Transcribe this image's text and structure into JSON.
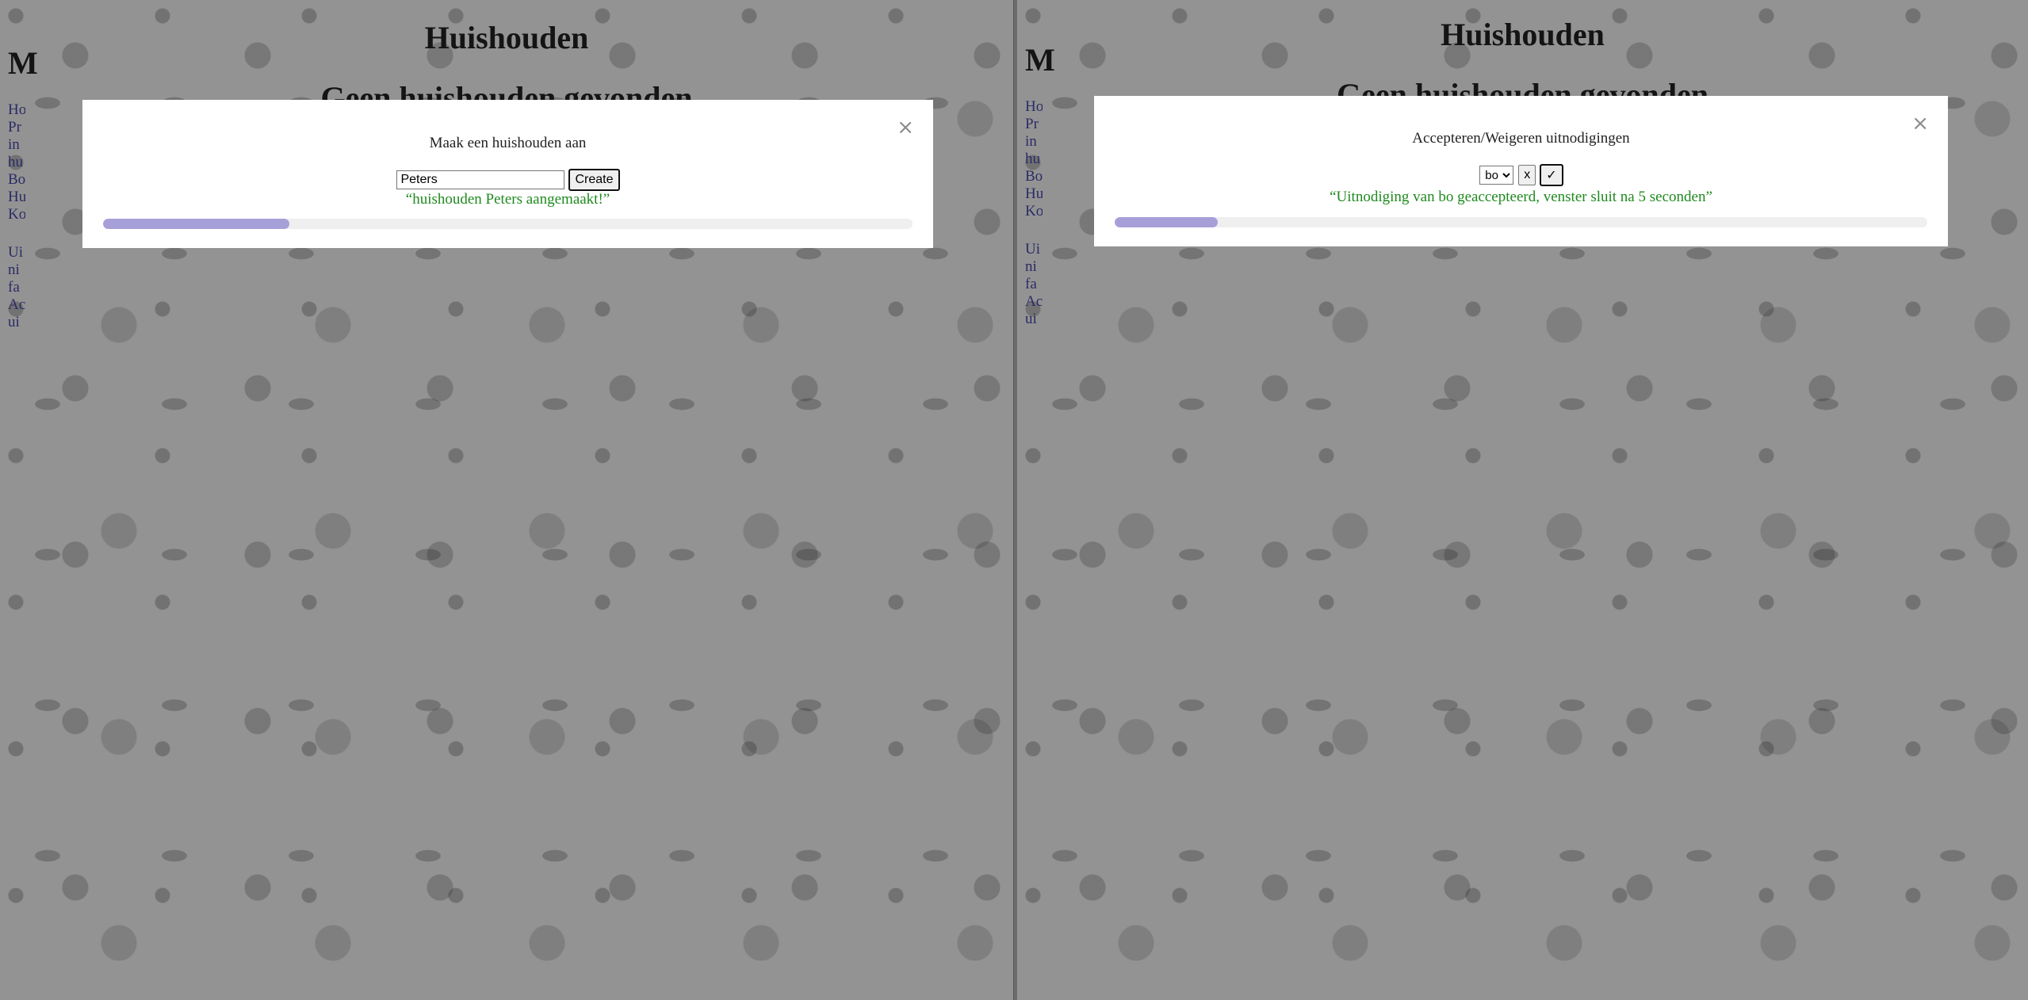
{
  "left": {
    "page_title": "Huishouden",
    "page_subtitle": "Geen huishouden gevonden",
    "side_letter": "M",
    "side_links": [
      "Ho",
      "Pr",
      "in",
      "hu",
      "Bo",
      "Hu",
      "Ko",
      "",
      "Ui",
      "ni",
      "fa",
      "Ac",
      "ui"
    ],
    "modal": {
      "title": "Maak een huishouden aan",
      "close_glyph": "×",
      "input_value": "Peters",
      "create_label": "Create",
      "message": "“huishouden Peters aangemaakt!”",
      "progress": 0.23
    }
  },
  "right": {
    "page_title": "Huishouden",
    "page_subtitle": "Geen huishouden gevonden",
    "side_letter": "M",
    "side_links": [
      "Ho",
      "Pr",
      "in",
      "hu",
      "Bo",
      "Hu",
      "Ko",
      "",
      "Ui",
      "ni",
      "fa",
      "Ac",
      "ui"
    ],
    "modal": {
      "title": "Accepteren/Weigeren uitnodigingen",
      "close_glyph": "×",
      "select_value": "bo",
      "reject_label": "x",
      "accept_label": "✓",
      "message": "“Uitnodiging van bo geaccepteerd, venster sluit na 5 seconden”",
      "progress": 0.127
    }
  },
  "colors": {
    "overlay": "#939393",
    "message_green": "#1f8a1f",
    "progress_fill": "#a79fd8",
    "progress_track": "#efefef"
  }
}
